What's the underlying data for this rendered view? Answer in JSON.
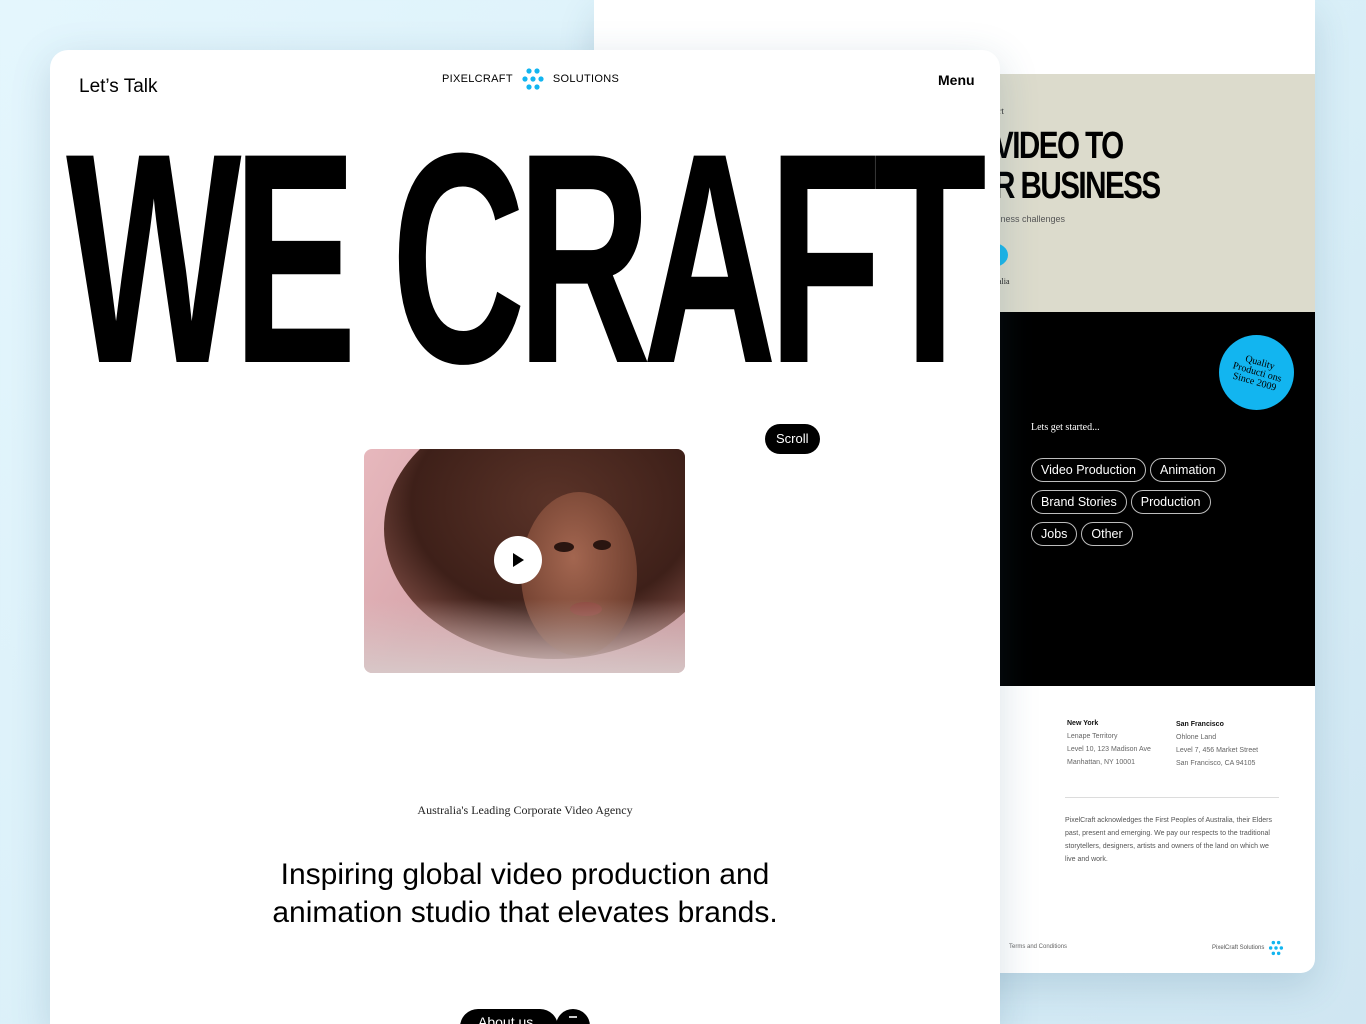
{
  "colors": {
    "accent": "#12b5f0",
    "beige": "#dcdbcc",
    "black": "#000000",
    "background": "#e4f6fd"
  },
  "front": {
    "header": {
      "lets_talk": "Let’s Talk",
      "brand_left": "PIXELCRAFT",
      "brand_right": "SOLUTIONS",
      "menu": "Menu"
    },
    "hero_title": "WE CRAFT",
    "scroll_label": "Scroll",
    "video": {
      "play_icon": "play-icon"
    },
    "tagline": "Australia's Leading Corporate Video Agency",
    "lead_line1": "Inspiring global video production and",
    "lead_line2": "animation studio that elevates brands.",
    "about_label": "About us"
  },
  "back": {
    "eyebrow": "ort",
    "heading_line1": "VIDEO TO",
    "heading_line2": "R BUSINESS",
    "subtitle": "siness challenges",
    "tag": "alia",
    "badge": "Quality Producti ons Since 2009",
    "started": "Lets get started...",
    "chips": [
      [
        "Video Production",
        "Animation"
      ],
      [
        "Brand Stories",
        "Production"
      ],
      [
        "Jobs",
        "Other"
      ]
    ],
    "offices": [
      {
        "city": "New York",
        "lines": [
          "Lenape Territory",
          "Level 10, 123 Madison Ave",
          "Manhattan, NY 10001"
        ]
      },
      {
        "city": "San Francisco",
        "lines": [
          "Ohlone Land",
          "Level 7, 456 Market Street",
          "San Francisco, CA 94105"
        ]
      }
    ],
    "acknowledgement": "PixelCraft acknowledges the First Peoples of Australia, their Elders past, present and emerging. We pay our respects to the traditional storytellers, designers, artists and owners of the land on which we live and work.",
    "terms": "Terms and Conditions",
    "footer_brand": "PixelCraft Solutions"
  }
}
